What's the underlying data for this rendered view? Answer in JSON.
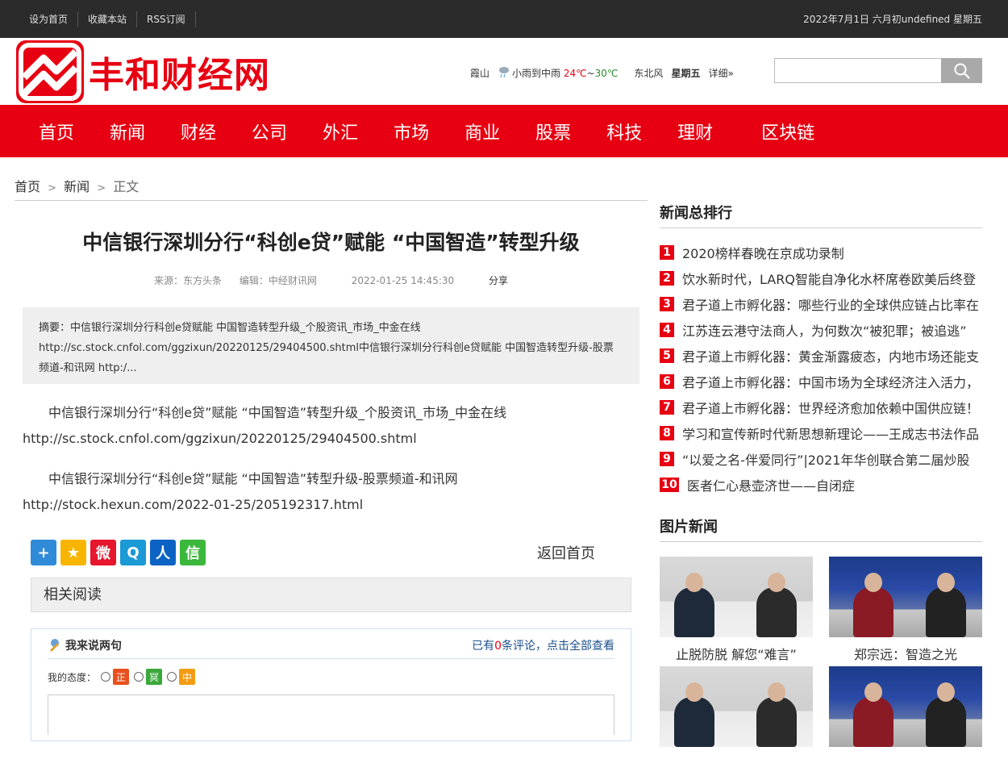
{
  "topbar": {
    "links": [
      "设为首页",
      "收藏本站",
      "RSS订阅"
    ],
    "date": "2022年7月1日 六月初undefined 星期五"
  },
  "header": {
    "logo_text": "丰和财经网",
    "weather": {
      "city": "霞山",
      "condition": "小雨到中雨",
      "temp_high": "24℃",
      "temp_sep": "~",
      "temp_low": "30℃",
      "wind": "东北风",
      "weekday": "星期五",
      "detail": "详细»"
    },
    "search_placeholder": ""
  },
  "nav": [
    "首页",
    "新闻",
    "财经",
    "公司",
    "外汇",
    "市场",
    "商业",
    "股票",
    "科技",
    "理财",
    "区块链"
  ],
  "breadcrumb": {
    "home": "首页",
    "sep": ">",
    "section": "新闻",
    "current": "正文"
  },
  "article": {
    "title": "中信银行深圳分行“科创e贷”赋能 “中国智造”转型升级",
    "source": "来源：东方头条",
    "editor": "编辑：中经财讯网",
    "time": "2022-01-25 14:45:30",
    "share": "分享",
    "summary": "摘要：中信银行深圳分行科创e贷赋能 中国智造转型升级_个股资讯_市场_中金在线 http://sc.stock.cnfol.com/ggzixun/20220125/29404500.shtml中信银行深圳分行科创e贷赋能 中国智造转型升级-股票频道-和讯网 http:/...",
    "paragraphs": [
      {
        "text": "中信银行深圳分行“科创e贷”赋能 “中国智造”转型升级_个股资讯_市场_中金在线",
        "url": "http://sc.stock.cnfol.com/ggzixun/20220125/29404500.shtml"
      },
      {
        "text": "中信银行深圳分行“科创e贷”赋能 “中国智造”转型升级-股票频道-和讯网",
        "url": "http://stock.hexun.com/2022-01-25/205192317.html"
      }
    ],
    "back_home": "返回首页",
    "related": "相关阅读"
  },
  "share_icons": [
    {
      "name": "plus-share-icon",
      "color": "#2f8ad8",
      "glyph": "+"
    },
    {
      "name": "qzone-icon",
      "color": "#f7b500",
      "glyph": "★"
    },
    {
      "name": "weibo-icon",
      "color": "#e6162d",
      "glyph": "微"
    },
    {
      "name": "tencent-weibo-icon",
      "color": "#1b9ad6",
      "glyph": "Q"
    },
    {
      "name": "renren-icon",
      "color": "#0c63c3",
      "glyph": "人"
    },
    {
      "name": "wechat-icon",
      "color": "#3bb83b",
      "glyph": "信"
    }
  ],
  "comment": {
    "title": "我来说两句",
    "count_prefix": "已有",
    "count": "0",
    "count_suffix": "条评论，点击全部查看",
    "attitude_label": "我的态度：",
    "attitudes": [
      {
        "label": "正",
        "color": "#e8501e"
      },
      {
        "label": "冥",
        "color": "#3aa83a"
      },
      {
        "label": "中",
        "color": "#f39c12"
      }
    ]
  },
  "sidebar": {
    "rank_title": "新闻总排行",
    "rank": [
      "2020榜样春晚在京成功录制",
      "饮水新时代，LARQ智能自净化水杯席卷欧美后终登",
      "君子道上市孵化器：哪些行业的全球供应链占比率在",
      "江苏连云港守法商人，为何数次“被犯罪；被追逃”",
      "君子道上市孵化器：黄金渐露疲态，内地市场还能支",
      "君子道上市孵化器：中国市场为全球经济注入活力，",
      "君子道上市孵化器：世界经济愈加依赖中国供应链！",
      "学习和宣传新时代新思想新理论——王成志书法作品",
      "“以爱之名-伴爱同行”|2021年华创联合第二届炒股",
      "医者仁心悬壶济世——自闭症"
    ],
    "pic_title": "图片新闻",
    "pics": [
      {
        "caption": "止脱防脱 解您“难言”",
        "style": "light"
      },
      {
        "caption": "郑宗远：智造之光",
        "style": "dark"
      },
      {
        "caption": "",
        "style": "light"
      },
      {
        "caption": "",
        "style": "dark"
      }
    ]
  }
}
